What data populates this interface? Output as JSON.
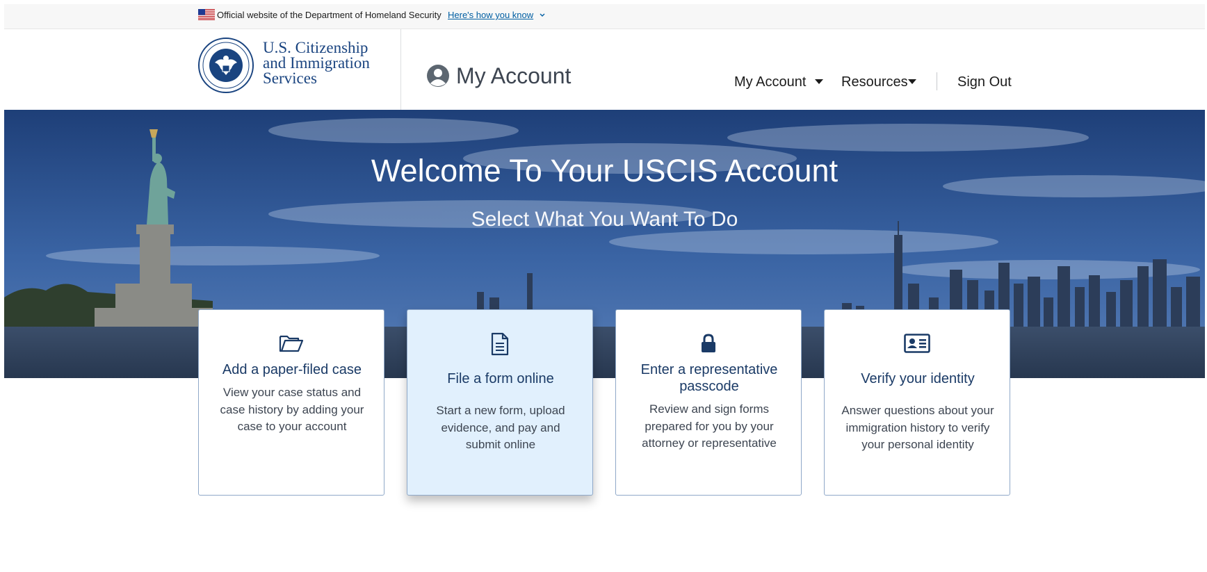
{
  "gov_banner": {
    "official_text": "Official website of the Department of Homeland Security",
    "how_you_know": "Here's how you know"
  },
  "header": {
    "logo_lines": [
      "U.S. Citizenship",
      "and Immigration",
      "Services"
    ],
    "account_title": "My Account",
    "nav": [
      {
        "label": "My Account",
        "has_dropdown": true
      },
      {
        "label": "Resources",
        "has_dropdown": true
      },
      {
        "label": "Sign Out",
        "has_dropdown": false
      }
    ]
  },
  "hero": {
    "title": "Welcome To Your USCIS Account",
    "subtitle": "Select What You Want To Do"
  },
  "cards": [
    {
      "icon": "folder-open-icon",
      "title": "Add a paper-filed case",
      "description": "View your case status and case history by adding your case to your account",
      "active": false
    },
    {
      "icon": "document-icon",
      "title": "File a form online",
      "description": "Start a new form, upload evidence, and pay and submit online",
      "active": true
    },
    {
      "icon": "lock-icon",
      "title": "Enter a representative passcode",
      "description": "Review and sign forms prepared for you by your attorney or representative",
      "active": false
    },
    {
      "icon": "id-card-icon",
      "title": "Verify your identity",
      "description": "Answer questions about your immigration history to verify your personal identity",
      "active": false
    }
  ],
  "colors": {
    "brand_navy": "#1a4480",
    "link_blue": "#005ea2",
    "card_active_bg": "#e1f0fd",
    "card_border": "#8fa8c8"
  }
}
